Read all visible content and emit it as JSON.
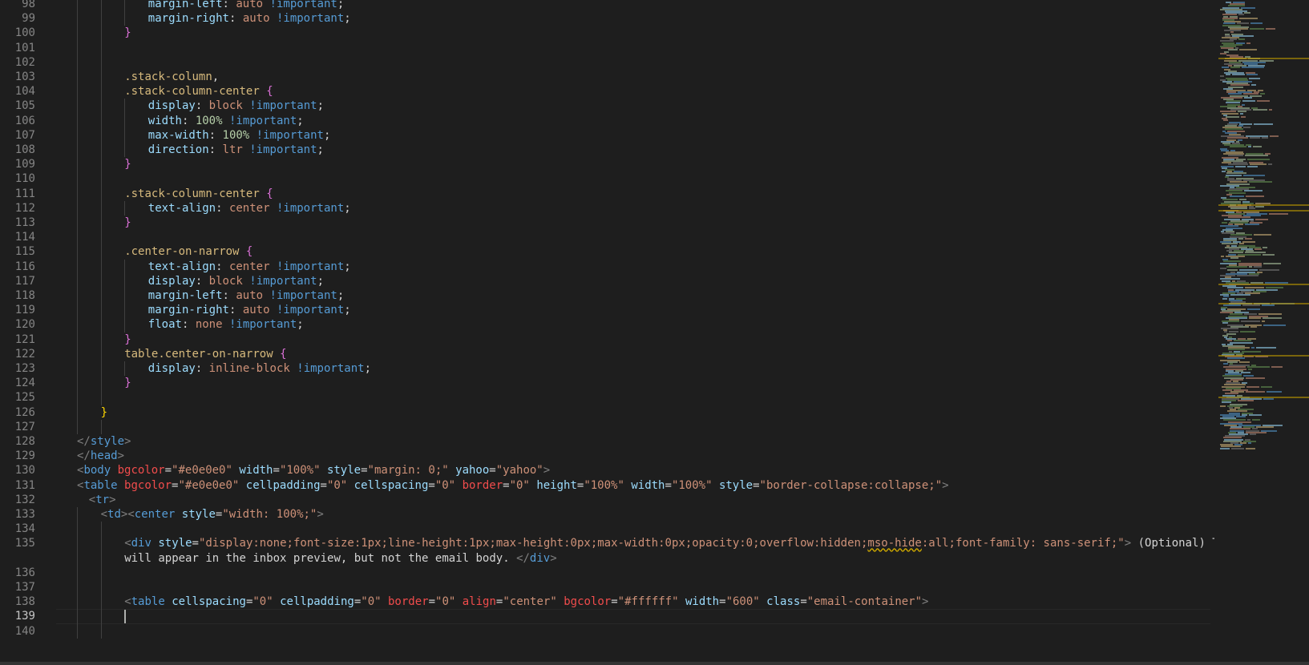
{
  "editor": {
    "active_line": "139",
    "lines": [
      {
        "n": "98",
        "indent": 3,
        "tokens": [
          [
            "prop",
            "margin-left"
          ],
          [
            "txt",
            ": "
          ],
          [
            "val",
            "auto"
          ],
          [
            "txt",
            " "
          ],
          [
            "imp",
            "!important"
          ],
          [
            "txt",
            ";"
          ]
        ]
      },
      {
        "n": "99",
        "indent": 3,
        "tokens": [
          [
            "prop",
            "margin-right"
          ],
          [
            "txt",
            ": "
          ],
          [
            "val",
            "auto"
          ],
          [
            "txt",
            " "
          ],
          [
            "imp",
            "!important"
          ],
          [
            "txt",
            ";"
          ]
        ]
      },
      {
        "n": "100",
        "indent": 2,
        "tokens": [
          [
            "b2",
            "}"
          ]
        ]
      },
      {
        "n": "101",
        "indent": 0,
        "tokens": []
      },
      {
        "n": "102",
        "indent": 0,
        "tokens": []
      },
      {
        "n": "103",
        "indent": 2,
        "tokens": [
          [
            "sel",
            ".stack-column"
          ],
          [
            "txt",
            ","
          ]
        ]
      },
      {
        "n": "104",
        "indent": 2,
        "tokens": [
          [
            "sel",
            ".stack-column-center"
          ],
          [
            "txt",
            " "
          ],
          [
            "b2",
            "{"
          ]
        ]
      },
      {
        "n": "105",
        "indent": 3,
        "tokens": [
          [
            "prop",
            "display"
          ],
          [
            "txt",
            ": "
          ],
          [
            "val",
            "block"
          ],
          [
            "txt",
            " "
          ],
          [
            "imp",
            "!important"
          ],
          [
            "txt",
            ";"
          ]
        ]
      },
      {
        "n": "106",
        "indent": 3,
        "tokens": [
          [
            "prop",
            "width"
          ],
          [
            "txt",
            ": "
          ],
          [
            "num",
            "100%"
          ],
          [
            "txt",
            " "
          ],
          [
            "imp",
            "!important"
          ],
          [
            "txt",
            ";"
          ]
        ]
      },
      {
        "n": "107",
        "indent": 3,
        "tokens": [
          [
            "prop",
            "max-width"
          ],
          [
            "txt",
            ": "
          ],
          [
            "num",
            "100%"
          ],
          [
            "txt",
            " "
          ],
          [
            "imp",
            "!important"
          ],
          [
            "txt",
            ";"
          ]
        ]
      },
      {
        "n": "108",
        "indent": 3,
        "tokens": [
          [
            "prop",
            "direction"
          ],
          [
            "txt",
            ": "
          ],
          [
            "val",
            "ltr"
          ],
          [
            "txt",
            " "
          ],
          [
            "imp",
            "!important"
          ],
          [
            "txt",
            ";"
          ]
        ]
      },
      {
        "n": "109",
        "indent": 2,
        "tokens": [
          [
            "b2",
            "}"
          ]
        ]
      },
      {
        "n": "110",
        "indent": 0,
        "tokens": []
      },
      {
        "n": "111",
        "indent": 2,
        "tokens": [
          [
            "sel",
            ".stack-column-center"
          ],
          [
            "txt",
            " "
          ],
          [
            "b2",
            "{"
          ]
        ]
      },
      {
        "n": "112",
        "indent": 3,
        "tokens": [
          [
            "prop",
            "text-align"
          ],
          [
            "txt",
            ": "
          ],
          [
            "val",
            "center"
          ],
          [
            "txt",
            " "
          ],
          [
            "imp",
            "!important"
          ],
          [
            "txt",
            ";"
          ]
        ]
      },
      {
        "n": "113",
        "indent": 2,
        "tokens": [
          [
            "b2",
            "}"
          ]
        ]
      },
      {
        "n": "114",
        "indent": 0,
        "tokens": []
      },
      {
        "n": "115",
        "indent": 2,
        "tokens": [
          [
            "sel",
            ".center-on-narrow"
          ],
          [
            "txt",
            " "
          ],
          [
            "b2",
            "{"
          ]
        ]
      },
      {
        "n": "116",
        "indent": 3,
        "tokens": [
          [
            "prop",
            "text-align"
          ],
          [
            "txt",
            ": "
          ],
          [
            "val",
            "center"
          ],
          [
            "txt",
            " "
          ],
          [
            "imp",
            "!important"
          ],
          [
            "txt",
            ";"
          ]
        ]
      },
      {
        "n": "117",
        "indent": 3,
        "tokens": [
          [
            "prop",
            "display"
          ],
          [
            "txt",
            ": "
          ],
          [
            "val",
            "block"
          ],
          [
            "txt",
            " "
          ],
          [
            "imp",
            "!important"
          ],
          [
            "txt",
            ";"
          ]
        ]
      },
      {
        "n": "118",
        "indent": 3,
        "tokens": [
          [
            "prop",
            "margin-left"
          ],
          [
            "txt",
            ": "
          ],
          [
            "val",
            "auto"
          ],
          [
            "txt",
            " "
          ],
          [
            "imp",
            "!important"
          ],
          [
            "txt",
            ";"
          ]
        ]
      },
      {
        "n": "119",
        "indent": 3,
        "tokens": [
          [
            "prop",
            "margin-right"
          ],
          [
            "txt",
            ": "
          ],
          [
            "val",
            "auto"
          ],
          [
            "txt",
            " "
          ],
          [
            "imp",
            "!important"
          ],
          [
            "txt",
            ";"
          ]
        ]
      },
      {
        "n": "120",
        "indent": 3,
        "tokens": [
          [
            "prop",
            "float"
          ],
          [
            "txt",
            ": "
          ],
          [
            "val",
            "none"
          ],
          [
            "txt",
            " "
          ],
          [
            "imp",
            "!important"
          ],
          [
            "txt",
            ";"
          ]
        ]
      },
      {
        "n": "121",
        "indent": 2,
        "tokens": [
          [
            "b2",
            "}"
          ]
        ]
      },
      {
        "n": "122",
        "indent": 2,
        "tokens": [
          [
            "sel",
            "table.center-on-narrow"
          ],
          [
            "txt",
            " "
          ],
          [
            "b2",
            "{"
          ]
        ]
      },
      {
        "n": "123",
        "indent": 3,
        "tokens": [
          [
            "prop",
            "display"
          ],
          [
            "txt",
            ": "
          ],
          [
            "val",
            "inline-block"
          ],
          [
            "txt",
            " "
          ],
          [
            "imp",
            "!important"
          ],
          [
            "txt",
            ";"
          ]
        ]
      },
      {
        "n": "124",
        "indent": 2,
        "tokens": [
          [
            "b2",
            "}"
          ]
        ]
      },
      {
        "n": "125",
        "indent": 0,
        "tokens": []
      },
      {
        "n": "126",
        "indent": 1,
        "tokens": [
          [
            "b1",
            "}"
          ]
        ]
      },
      {
        "n": "127",
        "indent": 0,
        "tokens": []
      },
      {
        "n": "128",
        "indent": 0,
        "tokens": [
          [
            "pun",
            "</"
          ],
          [
            "tag",
            "style"
          ],
          [
            "pun",
            ">"
          ]
        ]
      },
      {
        "n": "129",
        "indent": 0,
        "tokens": [
          [
            "pun",
            "</"
          ],
          [
            "tag",
            "head"
          ],
          [
            "pun",
            ">"
          ]
        ]
      },
      {
        "n": "130",
        "indent": 0,
        "tokens": [
          [
            "pun",
            "<"
          ],
          [
            "tag",
            "body"
          ],
          [
            "txt",
            " "
          ],
          [
            "attr-red",
            "bgcolor"
          ],
          [
            "txt",
            "="
          ],
          [
            "str",
            "\"#e0e0e0\""
          ],
          [
            "txt",
            " "
          ],
          [
            "attr",
            "width"
          ],
          [
            "txt",
            "="
          ],
          [
            "str",
            "\"100%\""
          ],
          [
            "txt",
            " "
          ],
          [
            "attr",
            "style"
          ],
          [
            "txt",
            "="
          ],
          [
            "str",
            "\"margin: 0;\""
          ],
          [
            "txt",
            " "
          ],
          [
            "attr",
            "yahoo"
          ],
          [
            "txt",
            "="
          ],
          [
            "str",
            "\"yahoo\""
          ],
          [
            "pun",
            ">"
          ]
        ]
      },
      {
        "n": "131",
        "indent": 0,
        "tokens": [
          [
            "pun",
            "<"
          ],
          [
            "tag",
            "table"
          ],
          [
            "txt",
            " "
          ],
          [
            "attr-red",
            "bgcolor"
          ],
          [
            "txt",
            "="
          ],
          [
            "str",
            "\"#e0e0e0\""
          ],
          [
            "txt",
            " "
          ],
          [
            "attr",
            "cellpadding"
          ],
          [
            "txt",
            "="
          ],
          [
            "str",
            "\"0\""
          ],
          [
            "txt",
            " "
          ],
          [
            "attr",
            "cellspacing"
          ],
          [
            "txt",
            "="
          ],
          [
            "str",
            "\"0\""
          ],
          [
            "txt",
            " "
          ],
          [
            "attr-red",
            "border"
          ],
          [
            "txt",
            "="
          ],
          [
            "str",
            "\"0\""
          ],
          [
            "txt",
            " "
          ],
          [
            "attr",
            "height"
          ],
          [
            "txt",
            "="
          ],
          [
            "str",
            "\"100%\""
          ],
          [
            "txt",
            " "
          ],
          [
            "attr",
            "width"
          ],
          [
            "txt",
            "="
          ],
          [
            "str",
            "\"100%\""
          ],
          [
            "txt",
            " "
          ],
          [
            "attr",
            "style"
          ],
          [
            "txt",
            "="
          ],
          [
            "str",
            "\"border-collapse:collapse;\""
          ],
          [
            "pun",
            ">"
          ]
        ]
      },
      {
        "n": "132",
        "indent": 0,
        "pad": 2,
        "tokens": [
          [
            "pun",
            "<"
          ],
          [
            "tag",
            "tr"
          ],
          [
            "pun",
            ">"
          ]
        ]
      },
      {
        "n": "133",
        "indent": 1,
        "tokens": [
          [
            "pun",
            "<"
          ],
          [
            "tag",
            "td"
          ],
          [
            "pun",
            "><"
          ],
          [
            "tag",
            "center"
          ],
          [
            "txt",
            " "
          ],
          [
            "attr",
            "style"
          ],
          [
            "txt",
            "="
          ],
          [
            "str",
            "\"width: 100%;\""
          ],
          [
            "pun",
            ">"
          ]
        ]
      },
      {
        "n": "134",
        "indent": 0,
        "tokens": []
      },
      {
        "n": "135",
        "indent": 2,
        "tokens": [
          [
            "pun",
            "<"
          ],
          [
            "tag",
            "div"
          ],
          [
            "txt",
            " "
          ],
          [
            "attr",
            "style"
          ],
          [
            "txt",
            "="
          ],
          [
            "str",
            "\"display:none;font-size:1px;line-height:1px;max-height:0px;max-width:0px;opacity:0;overflow:hidden;"
          ],
          [
            "squig",
            "mso-hide"
          ],
          [
            "str",
            ":all;font-family: sans-serif;\""
          ],
          [
            "pun",
            ">"
          ],
          [
            "txt",
            " (Optional) This text"
          ]
        ]
      },
      {
        "n": "",
        "indent": 2,
        "tokens": [
          [
            "txt",
            "will appear in the inbox preview, but not the email body. "
          ],
          [
            "pun",
            "</"
          ],
          [
            "tag",
            "div"
          ],
          [
            "pun",
            ">"
          ]
        ]
      },
      {
        "n": "136",
        "indent": 0,
        "tokens": []
      },
      {
        "n": "137",
        "indent": 0,
        "tokens": []
      },
      {
        "n": "138",
        "indent": 2,
        "tokens": [
          [
            "pun",
            "<"
          ],
          [
            "tag",
            "table"
          ],
          [
            "txt",
            " "
          ],
          [
            "attr",
            "cellspacing"
          ],
          [
            "txt",
            "="
          ],
          [
            "str",
            "\"0\""
          ],
          [
            "txt",
            " "
          ],
          [
            "attr",
            "cellpadding"
          ],
          [
            "txt",
            "="
          ],
          [
            "str",
            "\"0\""
          ],
          [
            "txt",
            " "
          ],
          [
            "attr-red",
            "border"
          ],
          [
            "txt",
            "="
          ],
          [
            "str",
            "\"0\""
          ],
          [
            "txt",
            " "
          ],
          [
            "attr-red",
            "align"
          ],
          [
            "txt",
            "="
          ],
          [
            "str",
            "\"center\""
          ],
          [
            "txt",
            " "
          ],
          [
            "attr-red",
            "bgcolor"
          ],
          [
            "txt",
            "="
          ],
          [
            "str",
            "\"#ffffff\""
          ],
          [
            "txt",
            " "
          ],
          [
            "attr",
            "width"
          ],
          [
            "txt",
            "="
          ],
          [
            "str",
            "\"600\""
          ],
          [
            "txt",
            " "
          ],
          [
            "attr",
            "class"
          ],
          [
            "txt",
            "="
          ],
          [
            "str",
            "\"email-container\""
          ],
          [
            "pun",
            ">"
          ]
        ]
      },
      {
        "n": "139",
        "indent": 0,
        "tokens": []
      },
      {
        "n": "140",
        "indent": 0,
        "tokens": []
      }
    ]
  }
}
